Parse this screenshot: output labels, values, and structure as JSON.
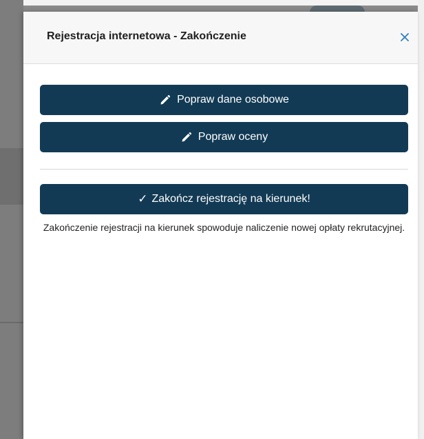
{
  "modal": {
    "title": "Rejestracja internetowa - Zakończenie",
    "close_label": "×"
  },
  "buttons": {
    "edit_personal_data": "Popraw dane osobowe",
    "edit_grades": "Popraw oceny",
    "finish_registration": "Zakończ rejestrację na kierunek!"
  },
  "icons": {
    "edit": "pencil-icon",
    "finish": "checkmark-icon",
    "close": "close-icon",
    "check_glyph": "✓"
  },
  "note": {
    "text": "Zakończenie rejestracji na kierunek spowoduje naliczenie nowej opłaty rekrutacyjnej."
  },
  "colors": {
    "button_bg": "#123a54",
    "close_icon": "#2f7fc1",
    "header_bg": "#f7f7f7"
  }
}
